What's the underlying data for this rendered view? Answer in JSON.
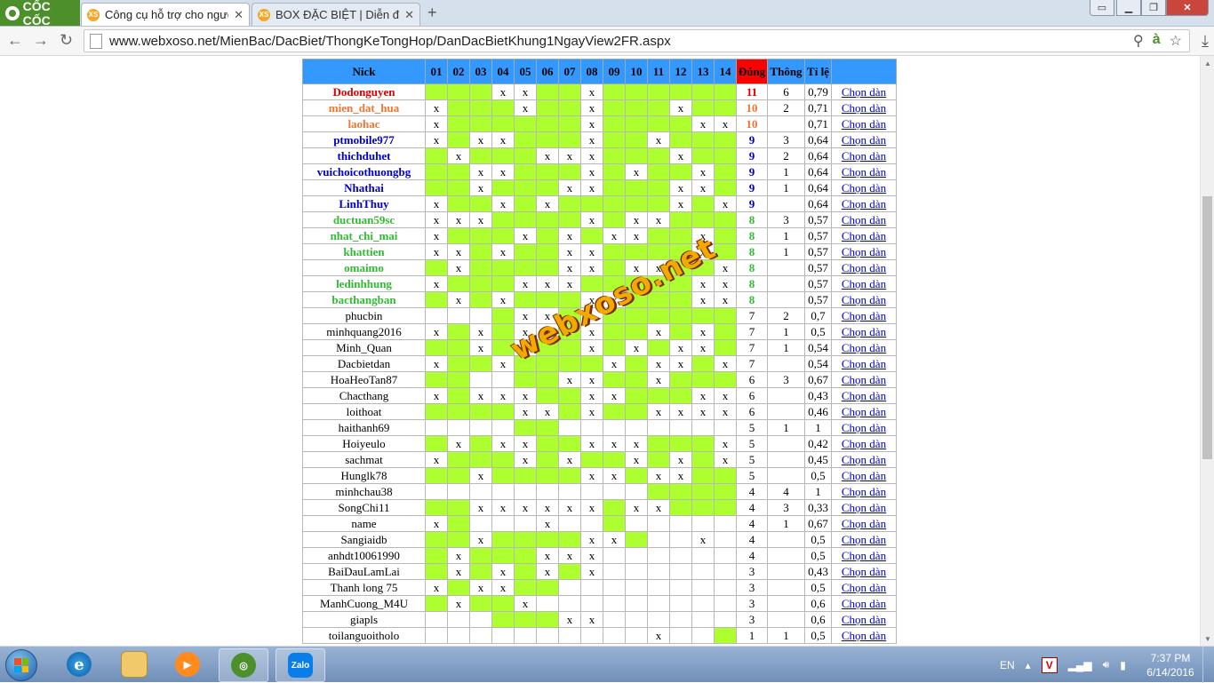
{
  "browser": {
    "logo_text": "CỐC CỐC",
    "tabs": [
      {
        "label": "Công cụ hỗ trợ cho người",
        "favicon": "XS",
        "close": "✕"
      },
      {
        "label": "BOX ĐẶC BIỆT | Diễn đàn",
        "favicon": "XS",
        "close": "✕"
      }
    ],
    "new_tab": "+",
    "url": "www.webxoso.net/MienBac/DacBiet/ThongKeTongHop/DanDacBietKhung1NgayView2FR.aspx"
  },
  "table": {
    "headers": {
      "nick": "Nick",
      "days": [
        "01",
        "02",
        "03",
        "04",
        "05",
        "06",
        "07",
        "08",
        "09",
        "10",
        "11",
        "12",
        "13",
        "14"
      ],
      "dung": "Đúng",
      "thong": "Thông",
      "tile": "Tỉ lệ"
    },
    "link_label": "Chọn dàn",
    "mark": "x",
    "rows": [
      {
        "nick": "Dodonguyen",
        "level": "red",
        "cells": "GGGxxGGxGGGGGG",
        "marks": "000110010000000",
        "dung": "11",
        "thong": "6",
        "tile": "0,79"
      },
      {
        "nick": "mien_dat_hua",
        "level": "orange",
        "cells": "xGGGxGGxGGGxGG",
        "dung": "10",
        "thong": "2",
        "tile": "0,71"
      },
      {
        "nick": "laohac",
        "level": "orange",
        "cells": "xGGGGGGxGGGGxx",
        "dung": "10",
        "thong": "",
        "tile": "0,71"
      },
      {
        "nick": "ptmobile977",
        "level": "blue",
        "cells": "xGxxGGGxGGxGGG",
        "dung": "9",
        "thong": "3",
        "tile": "0,64"
      },
      {
        "nick": "thichduhet",
        "level": "blue",
        "cells": "GxGGGxxxGGGxGG",
        "dung": "9",
        "thong": "2",
        "tile": "0,64"
      },
      {
        "nick": "vuichoicothuongbg",
        "level": "blue",
        "cells": "GGxxGGGxGxGGxG",
        "dung": "9",
        "thong": "1",
        "tile": "0,64"
      },
      {
        "nick": "Nhathai",
        "level": "blue",
        "cells": "GGxGGGxxGGGxxG",
        "dung": "9",
        "thong": "1",
        "tile": "0,64"
      },
      {
        "nick": "LinhThuy",
        "level": "blue",
        "cells": "xGGxGxGGGGGxGx",
        "dung": "9",
        "thong": "",
        "tile": "0,64"
      },
      {
        "nick": "ductuan59sc",
        "level": "green",
        "cells": "xxxGGGGxGxxGGG",
        "dung": "8",
        "thong": "3",
        "tile": "0,57"
      },
      {
        "nick": "nhat_chi_mai",
        "level": "green",
        "cells": "xGGGxGxGxxGGxG",
        "dung": "8",
        "thong": "1",
        "tile": "0,57"
      },
      {
        "nick": "khattien",
        "level": "green",
        "cells": "xxGxGGxxGGGGxG",
        "dung": "8",
        "thong": "1",
        "tile": "0,57"
      },
      {
        "nick": "omaimo",
        "level": "green",
        "cells": "GxGGGGxxGxxGGx",
        "dung": "8",
        "thong": "",
        "tile": "0,57"
      },
      {
        "nick": "ledinhhung",
        "level": "green",
        "cells": "xGGGxxxGGGGGxx",
        "dung": "8",
        "thong": "",
        "tile": "0,57"
      },
      {
        "nick": "bacthangban",
        "level": "green",
        "cells": "GxGxGGGxxGGGxx",
        "dung": "8",
        "thong": "",
        "tile": "0,57"
      },
      {
        "nick": "phucbin",
        "level": "plain",
        "cells": "...GxxG.GGGGGG",
        "dung": "7",
        "thong": "2",
        "tile": "0,7"
      },
      {
        "nick": "minhquang2016",
        "level": "plain",
        "cells": "xGxGxxGxGGxGxG",
        "dung": "7",
        "thong": "1",
        "tile": "0,5"
      },
      {
        "nick": "Minh_Quan",
        "level": "plain",
        "cells": "GGxGxGGxGxGxxG",
        "dung": "7",
        "thong": "1",
        "tile": "0,54"
      },
      {
        "nick": "Dacbietdan",
        "level": "plain",
        "cells": "xGGxGGGGxGxxGx",
        "dung": "7",
        "thong": "",
        "tile": "0,54"
      },
      {
        "nick": "HoaHeoTan87",
        "level": "plain",
        "cells": "GG..GGxxGGxGGG",
        "dung": "6",
        "thong": "3",
        "tile": "0,67"
      },
      {
        "nick": "Chacthang",
        "level": "plain",
        "cells": "xGxxxGGxxGGGxx",
        "dung": "6",
        "thong": "",
        "tile": "0,43"
      },
      {
        "nick": "loithoat",
        "level": "plain",
        "cells": "GGGGxxGxGGxxxx",
        "dung": "6",
        "thong": "",
        "tile": "0,46"
      },
      {
        "nick": "haithanh69",
        "level": "plain",
        "cells": "....GG........",
        "dung": "5",
        "thong": "1",
        "tile": "1"
      },
      {
        "nick": "Hoiyeulo",
        "level": "plain",
        "cells": "GxGxxGGxxxGGGx",
        "dung": "5",
        "thong": "",
        "tile": "0,42"
      },
      {
        "nick": "sachmat",
        "level": "plain",
        "cells": "xGGGxGxGGxGxGx",
        "dung": "5",
        "thong": "",
        "tile": "0,45"
      },
      {
        "nick": "Hunglk78",
        "level": "plain",
        "cells": "GGxGGGGxxGxxGG",
        "dung": "5",
        "thong": "",
        "tile": "0,5"
      },
      {
        "nick": "minhchau38",
        "level": "plain",
        "cells": "..........GGGG",
        "dung": "4",
        "thong": "4",
        "tile": "1"
      },
      {
        "nick": "SongChi11",
        "level": "plain",
        "cells": "GGxxxxxxGxxGGG",
        "dung": "4",
        "thong": "3",
        "tile": "0,33"
      },
      {
        "nick": "name",
        "level": "plain",
        "cells": "xG...x..G.....",
        "dung": "4",
        "thong": "1",
        "tile": "0,67"
      },
      {
        "nick": "Sangiaidb",
        "level": "plain",
        "cells": "GGxGGGGxxG..x.",
        "dung": "4",
        "thong": "",
        "tile": "0,5"
      },
      {
        "nick": "anhdt10061990",
        "level": "plain",
        "cells": "GxGGGxxx......",
        "dung": "4",
        "thong": "",
        "tile": "0,5"
      },
      {
        "nick": "BaiDauLamLai",
        "level": "plain",
        "cells": "GxGxGxGx......",
        "dung": "3",
        "thong": "",
        "tile": "0,43"
      },
      {
        "nick": "Thanh long 75",
        "level": "plain",
        "cells": "xGxxGG........",
        "dung": "3",
        "thong": "",
        "tile": "0,5"
      },
      {
        "nick": "ManhCuong_M4U",
        "level": "plain",
        "cells": "GxGGx.........",
        "dung": "3",
        "thong": "",
        "tile": "0,6"
      },
      {
        "nick": "giapls",
        "level": "plain",
        "cells": "...GGGxx......",
        "dung": "3",
        "thong": "",
        "tile": "0,6"
      },
      {
        "nick": "toilanguoitholo",
        "level": "plain",
        "cells": "..........x..G",
        "dung": "1",
        "thong": "1",
        "tile": "0,5"
      }
    ]
  },
  "watermark": "webxoso.net",
  "taskbar": {
    "zalo_label": "Zalo",
    "lang": "EN",
    "time": "7:37 PM",
    "date": "6/14/2016"
  },
  "colors": {
    "header_blue": "#3399ff",
    "dung_red": "#ff0000",
    "hit_green": "#adff2f"
  }
}
